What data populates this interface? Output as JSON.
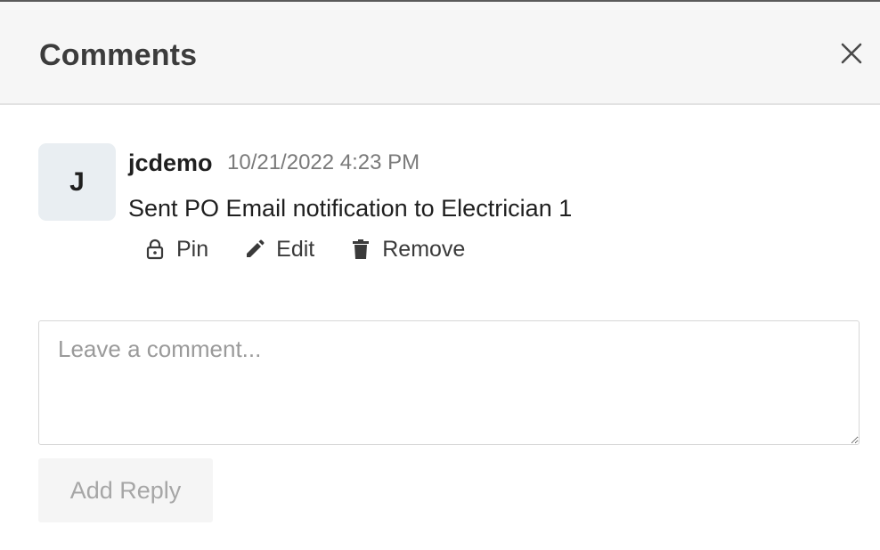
{
  "header": {
    "title": "Comments",
    "close_icon": "close-icon"
  },
  "comment": {
    "avatar_initial": "J",
    "author": "jcdemo",
    "timestamp": "10/21/2022 4:23 PM",
    "text": "Sent PO Email notification to Electrician 1",
    "actions": {
      "pin": {
        "label": "Pin",
        "icon": "lock-icon"
      },
      "edit": {
        "label": "Edit",
        "icon": "pencil-icon"
      },
      "remove": {
        "label": "Remove",
        "icon": "trash-icon"
      }
    }
  },
  "reply": {
    "placeholder": "Leave a comment...",
    "value": "",
    "button_label": "Add Reply",
    "button_disabled": true
  },
  "colors": {
    "header_bg": "#f6f6f6",
    "avatar_bg": "#e9eef2",
    "muted_text": "#7a7a7a",
    "disabled_button_bg": "#f5f5f5"
  }
}
